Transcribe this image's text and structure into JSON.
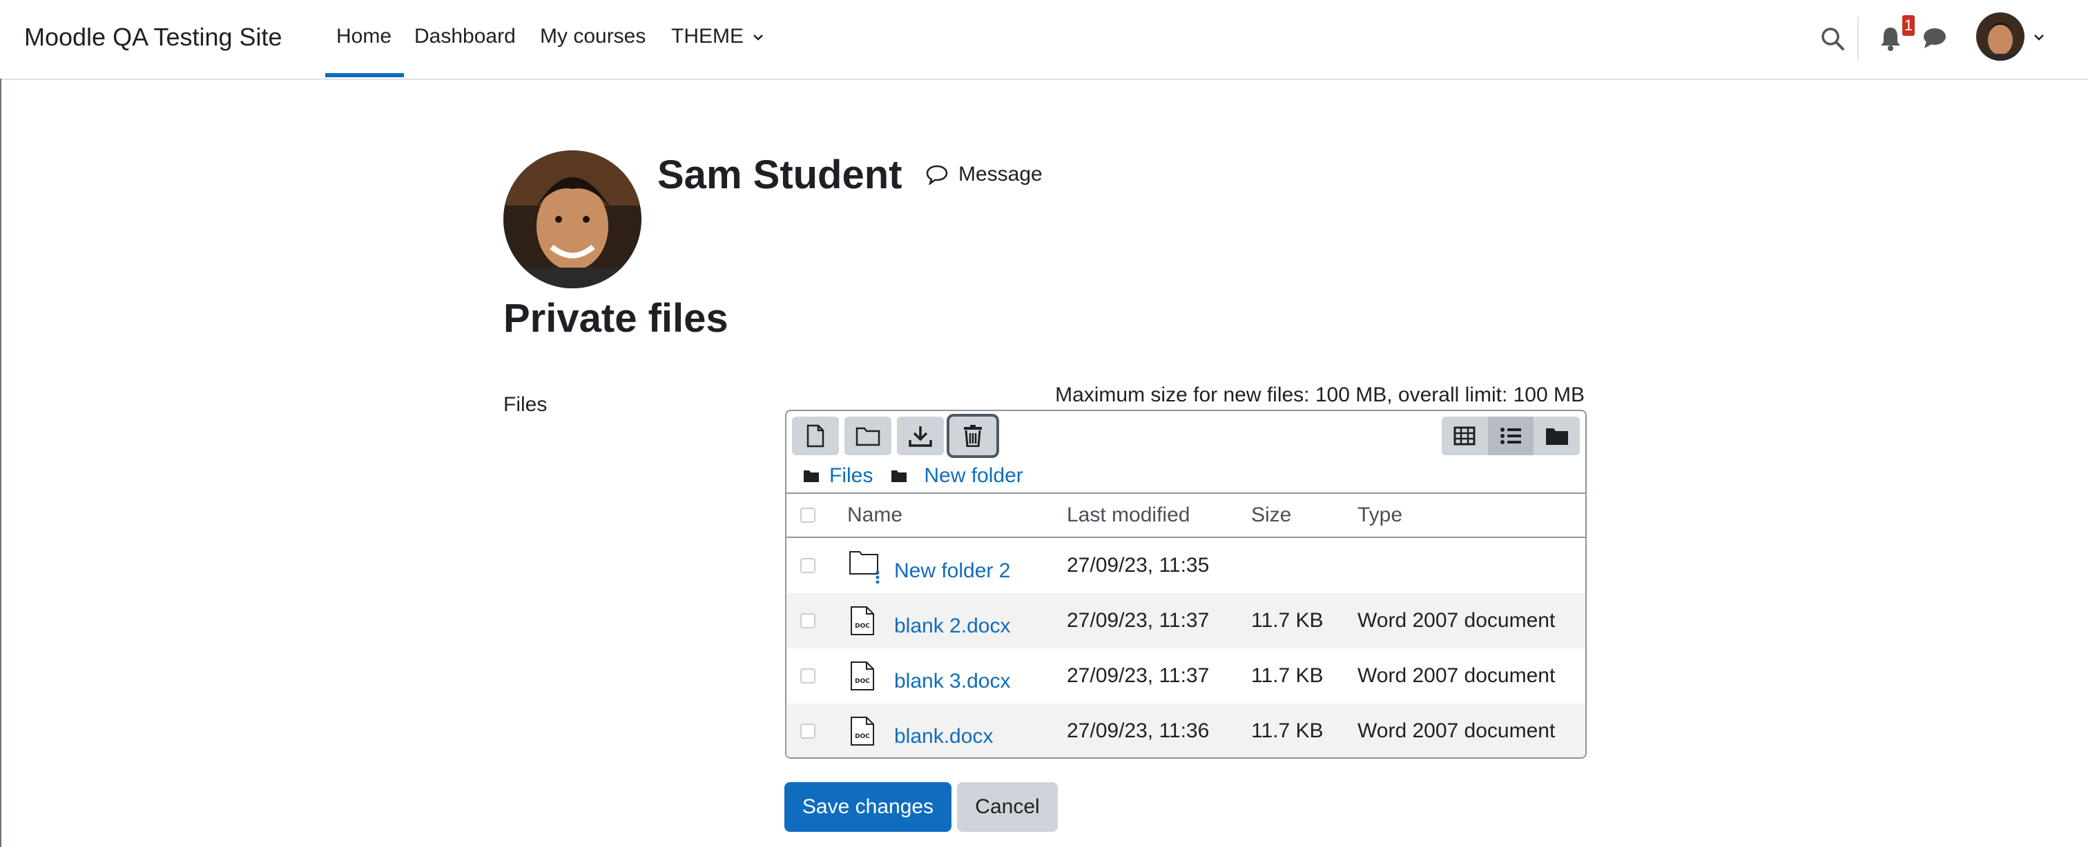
{
  "site": {
    "name": "Moodle QA Testing Site"
  },
  "nav": {
    "items": [
      {
        "label": "Home"
      },
      {
        "label": "Dashboard"
      },
      {
        "label": "My courses"
      },
      {
        "label": "THEME"
      }
    ],
    "notification_count": "1"
  },
  "profile": {
    "name": "Sam Student",
    "message_label": "Message"
  },
  "page": {
    "title": "Private files"
  },
  "files": {
    "label": "Files",
    "max_size": "Maximum size for new files: 100 MB, overall limit: 100 MB",
    "breadcrumb": [
      "Files",
      "New folder"
    ],
    "columns": {
      "name": "Name",
      "modified": "Last modified",
      "size": "Size",
      "type": "Type"
    },
    "rows": [
      {
        "name": "New folder 2",
        "modified": "27/09/23, 11:35",
        "size": "",
        "type": "",
        "icon": "folder-icon"
      },
      {
        "name": "blank 2.docx",
        "modified": "27/09/23, 11:37",
        "size": "11.7 KB",
        "type": "Word 2007 document",
        "icon": "doc-icon"
      },
      {
        "name": "blank 3.docx",
        "modified": "27/09/23, 11:37",
        "size": "11.7 KB",
        "type": "Word 2007 document",
        "icon": "doc-icon"
      },
      {
        "name": "blank.docx",
        "modified": "27/09/23, 11:36",
        "size": "11.7 KB",
        "type": "Word 2007 document",
        "icon": "doc-icon"
      }
    ]
  },
  "actions": {
    "save": "Save changes",
    "cancel": "Cancel"
  },
  "colors": {
    "primary": "#0f6cbf",
    "badge": "#ca3120",
    "button_secondary": "#ced4da"
  }
}
